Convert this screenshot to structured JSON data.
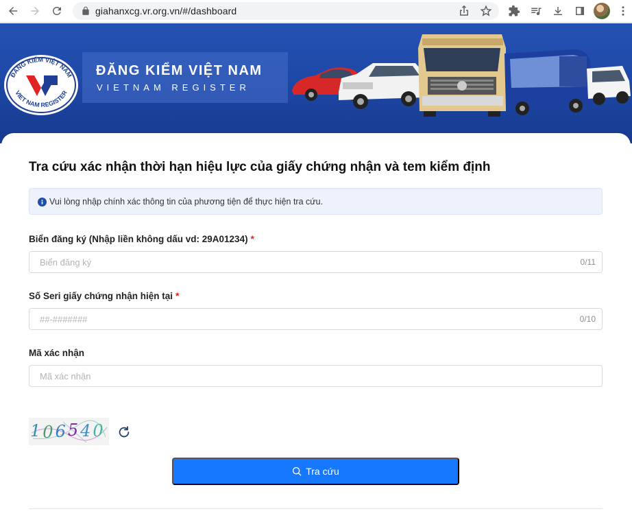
{
  "browser": {
    "url": "giahanxcg.vr.org.vn/#/dashboard"
  },
  "banner": {
    "logo_top_text": "ĐĂNG KIỂM VIỆT NAM",
    "logo_bottom_text": "VIET NAM REGISTER",
    "brand_vn": "ĐĂNG KIỂM VIỆT NAM",
    "brand_en": "VIETNAM REGISTER"
  },
  "form": {
    "title": "Tra cứu xác nhận thời hạn hiệu lực của giấy chứng nhận và tem kiểm định",
    "info": "Vui lòng nhập chính xác thông tin của phương tiện để thực hiện tra cứu.",
    "plate": {
      "label": "Biển đăng ký (Nhập liền không dấu vd: 29A01234)",
      "required_mark": "*",
      "placeholder": "Biển đăng ký",
      "counter": "0/11"
    },
    "serial": {
      "label": "Số Seri giấy chứng nhận hiện tại",
      "required_mark": "*",
      "placeholder": "##-#######",
      "counter": "0/10"
    },
    "captcha_field": {
      "label": "Mã xác nhận",
      "placeholder": "Mã xác nhận"
    },
    "captcha_code": "106540",
    "submit_label": "Tra cứu"
  },
  "colors": {
    "primary": "#1677ff",
    "banner_blue": "#1e48a8",
    "required": "#e02424"
  }
}
